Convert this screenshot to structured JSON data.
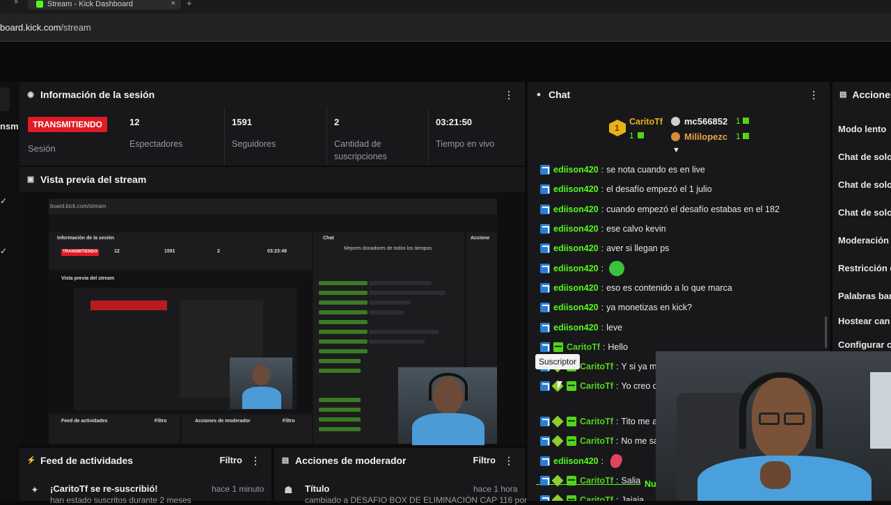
{
  "browser": {
    "tab_title": "Stream - Kick Dashboard",
    "url_prefix": "board.kick.com",
    "url_path": "/stream",
    "new_tab": "+",
    "close_tab": "×"
  },
  "left": {
    "partial_text": "nsm"
  },
  "session": {
    "title": "Información de la sesión",
    "live_badge": "TRANSMITIENDO",
    "session_label": "Sesión",
    "stats": [
      {
        "value": "12",
        "label": "Espectadores"
      },
      {
        "value": "1591",
        "label": "Seguidores"
      },
      {
        "value": "2",
        "label": "Cantidad de suscripciones"
      },
      {
        "value": "03:21:50",
        "label": "Tiempo en vivo"
      }
    ]
  },
  "preview": {
    "title": "Vista previa del stream"
  },
  "feed": {
    "title": "Feed de actividades",
    "filter": "Filtro",
    "item": "¡CaritoTf se re-suscribió!",
    "item_time": "hace 1 minuto",
    "item_sub": "han estado suscritos durante 2 meses"
  },
  "modactions": {
    "title": "Acciones de moderador",
    "filter": "Filtro",
    "item": "Título",
    "item_time": "hace 1 hora",
    "item_sub": "cambiado a DESAFIO BOX DE ELIMINACIÓN CAP 116 por"
  },
  "chat": {
    "title": "Chat",
    "donors": [
      {
        "name": "CaritoTf",
        "count": "1",
        "rank": "1"
      },
      {
        "name": "mc566852",
        "count": "1"
      },
      {
        "name": "Mililopezc",
        "count": "1"
      }
    ],
    "messages": [
      {
        "user": "ediison420",
        "text": "se nota cuando es en live",
        "badges": [
          "blue"
        ]
      },
      {
        "user": "ediison420",
        "text": "el desafío empezó el 1 julio",
        "badges": [
          "blue"
        ]
      },
      {
        "user": "ediison420",
        "text": "cuando empezó el desafío estabas en el 182",
        "badges": [
          "blue"
        ]
      },
      {
        "user": "ediison420",
        "text": "ese calvo kevin",
        "badges": [
          "blue"
        ]
      },
      {
        "user": "ediison420",
        "text": "aver si llegan ps",
        "badges": [
          "blue"
        ]
      },
      {
        "user": "ediison420",
        "text": "",
        "badges": [
          "blue"
        ],
        "emote": "green"
      },
      {
        "user": "ediison420",
        "text": "eso es contenido a lo que marca",
        "badges": [
          "blue"
        ]
      },
      {
        "user": "ediison420",
        "text": "ya monetizas en kick?",
        "badges": [
          "blue"
        ]
      },
      {
        "user": "ediison420",
        "text": "leve",
        "badges": [
          "blue"
        ]
      },
      {
        "user": "CaritoTf",
        "text": "Hello",
        "badges": [
          "blue",
          "green"
        ]
      },
      {
        "user": "CaritoTf",
        "text": "Y si ya me su",
        "badges": [
          "blue",
          "star",
          "green"
        ]
      },
      {
        "user": "CaritoTf",
        "text": "Yo creo q",
        "badges": [
          "blue",
          "star",
          "green"
        ]
      }
    ],
    "new_label": "Nue",
    "messages_after": [
      {
        "user": "CaritoTf",
        "text": "Tito me a",
        "badges": [
          "blue",
          "star",
          "green"
        ]
      },
      {
        "user": "CaritoTf",
        "text": "No me sa",
        "badges": [
          "blue",
          "star",
          "green"
        ]
      },
      {
        "user": "ediison420",
        "text": "",
        "badges": [
          "blue"
        ],
        "emote": "red"
      },
      {
        "user": "CaritoTf",
        "text": "Salia",
        "badges": [
          "blue",
          "star",
          "green"
        ]
      },
      {
        "user": "CaritoTf",
        "text": "Jajaja",
        "badges": [
          "blue",
          "star",
          "green"
        ]
      }
    ],
    "tooltip": "Suscriptor"
  },
  "actions": {
    "title": "Acciones",
    "items": [
      "Modo lento",
      "Chat de solo",
      "Chat de solo",
      "Chat de solo",
      "Moderación",
      "Restricción d",
      "Palabras ban",
      "Hostear can",
      "Configurar c"
    ]
  },
  "mini": {
    "url": "board.kick.com/stream",
    "session": "Información de la sesión",
    "live": "TRANSMITIENDO",
    "values": [
      "12",
      "1591",
      "2",
      "03:23:48"
    ],
    "chat": "Chat",
    "donors": "Mejores donadores de todos los tiempos",
    "preview": "Vista previa del stream",
    "feed": "Feed de actividades",
    "mod": "Acciones de moderador",
    "filter": "Filtro",
    "acciones": "Accione"
  }
}
